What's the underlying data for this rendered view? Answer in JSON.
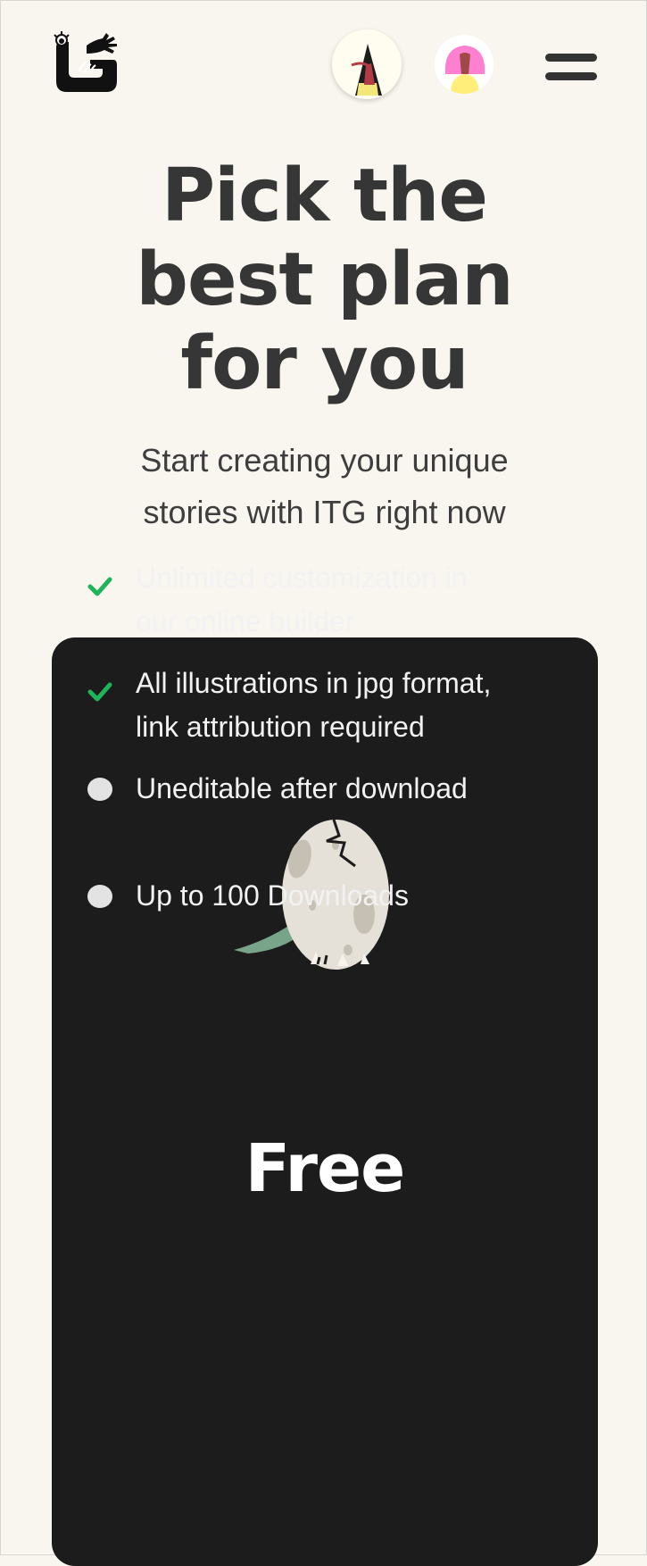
{
  "header": {
    "logo_icon": "itg-logo-icon",
    "avatar_a_icon": "character-avatar-icon",
    "avatar_b_icon": "pink-hair-avatar-icon",
    "menu_icon": "hamburger-menu-icon"
  },
  "hero": {
    "title_lines": [
      "Pick the",
      "best plan",
      "for you"
    ],
    "subtitle_lines": [
      "Start creating your unique",
      "stories with ITG right now"
    ]
  },
  "plan": {
    "illustration_icon": "cracked-egg-icon",
    "name": "Free",
    "features": [
      {
        "status": "check",
        "lines": [
          "Unlimited customization in",
          "our online builder"
        ]
      },
      {
        "status": "check",
        "lines": [
          "All illustrations in jpg format,",
          "link attribution required"
        ]
      },
      {
        "status": "dot",
        "lines": [
          "Uneditable after download"
        ]
      },
      {
        "status": "dot",
        "lines": [
          "Up to 100 Downloads"
        ]
      }
    ]
  },
  "colors": {
    "page_bg": "#f9f6f0",
    "card_bg": "#1c1c1c",
    "check_green": "#1fb35a",
    "heading_text": "#363636"
  }
}
